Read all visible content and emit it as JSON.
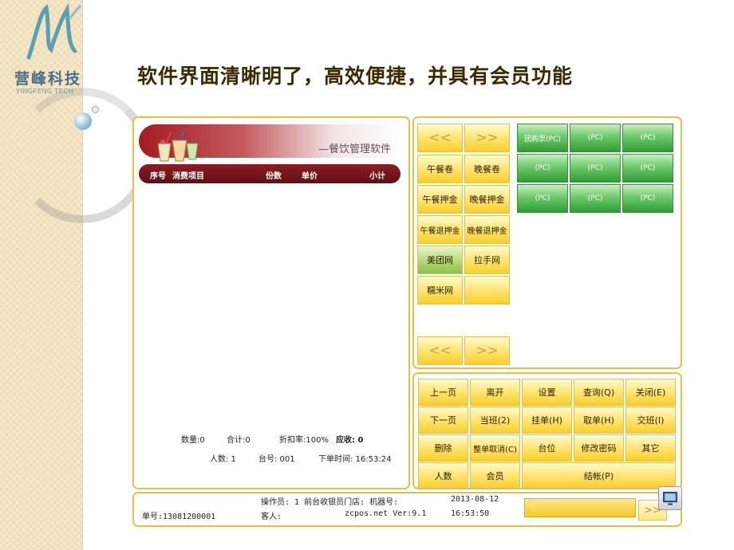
{
  "branding": {
    "logo_text": "营峰科技",
    "logo_sub": "YINGFENG TECH",
    "headline": "软件界面清晰明了，高效便捷，并具有会员功能"
  },
  "order": {
    "banner_title": "—餐饮管理软件",
    "columns": {
      "no": "序号",
      "item": "消费项目",
      "qty": "份数",
      "price": "单价",
      "subtotal": "小计"
    },
    "summary": {
      "quantity": "数量:0",
      "total": "合计:0",
      "discount": "折扣率:100%",
      "due": "应收: 0",
      "people": "人数: 1",
      "table": "台号: 001",
      "order_time": "下单时间: 16:53:24"
    }
  },
  "menu": {
    "prev_label": "<<",
    "next_label": ">>",
    "categories": [
      "午餐卷",
      "晚餐卷",
      "午餐押金",
      "晚餐押金",
      "午餐退押金",
      "晚餐退押金",
      "美团网",
      "拉手网",
      "糯米网",
      ""
    ],
    "items": [
      "团购票(PC)",
      "(PC)",
      "(PC)",
      "(PC)",
      "(PC)",
      "(PC)",
      "(PC)",
      "(PC)",
      "(PC)"
    ]
  },
  "actions": {
    "row1": [
      "上一页",
      "离开",
      "设置",
      "查询(Q)",
      "关闭(E)"
    ],
    "row2": [
      "下一页",
      "当班(2)",
      "挂单(H)",
      "取单(H)",
      "交班(I)"
    ],
    "row3": [
      "删除",
      "整单取消(C)",
      "台位",
      "修改密码",
      "其它"
    ],
    "people": "人数",
    "member": "会员",
    "checkout": "结帐(P)"
  },
  "status": {
    "operator": "操作员: 1 前台收银员门店: 机器号:",
    "date": "2013-08-12",
    "order_no": "单号:13081200001",
    "guest": "客人:",
    "version": "zcpos.net Ver:9.1",
    "time": "16:53:50",
    "go_label": ">>"
  },
  "colors": {
    "accent_yellow": "#f7cf2a",
    "green_button": "#2f9b35",
    "banner_red": "#a31c22",
    "panel_border": "#e4c24a"
  }
}
